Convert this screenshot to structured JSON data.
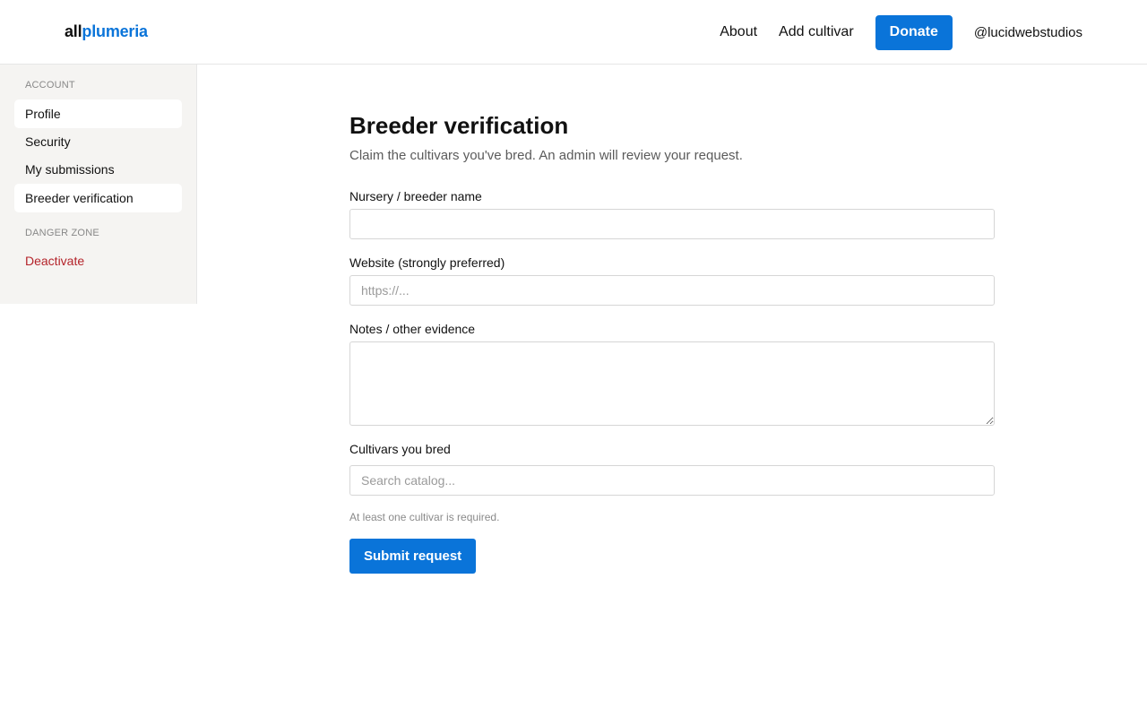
{
  "header": {
    "logo_part_1": "all",
    "logo_part_2": "plumeria",
    "nav": {
      "about": "About",
      "add_cultivar": "Add cultivar",
      "donate": "Donate",
      "user": "@lucidwebstudios"
    }
  },
  "sidebar": {
    "account_title": "ACCOUNT",
    "account_items": [
      {
        "label": "Profile",
        "active": true
      },
      {
        "label": "Security",
        "active": false
      },
      {
        "label": "My submissions",
        "active": false
      },
      {
        "label": "Breeder verification",
        "active": true
      }
    ],
    "danger_title": "DANGER ZONE",
    "danger_items": [
      {
        "label": "Deactivate"
      }
    ]
  },
  "main": {
    "title": "Breeder verification",
    "subtitle": "Claim the cultivars you've bred. An admin will review your request.",
    "fields": {
      "nursery": {
        "label": "Nursery / breeder name",
        "value": "",
        "placeholder": ""
      },
      "website": {
        "label": "Website (strongly preferred)",
        "value": "",
        "placeholder": "https://..."
      },
      "notes": {
        "label": "Notes / other evidence",
        "value": "",
        "placeholder": ""
      },
      "cultivars": {
        "label": "Cultivars you bred",
        "value": "",
        "placeholder": "Search catalog..."
      }
    },
    "hint": "At least one cultivar is required.",
    "submit_label": "Submit request"
  },
  "colors": {
    "accent": "#0a74d9",
    "danger": "#b4232a",
    "sidebar_bg": "#f5f4f2"
  }
}
